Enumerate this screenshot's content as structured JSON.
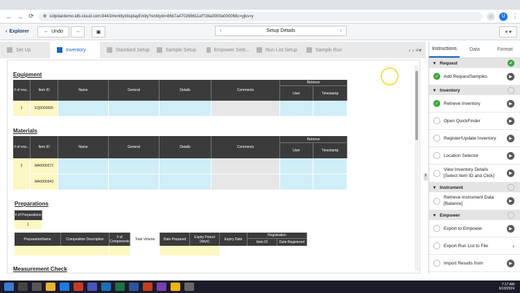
{
  "browser": {
    "url": "solpdardemo.idb-cloud.com:8443/#entity/displayEntity?entityId=86b7a470268611ef?28a0000a000068c=yjks=y"
  },
  "toolbar": {
    "explorer": "Explorer",
    "undo": "Undo",
    "title": "Setup Details"
  },
  "tabs": [
    "Set Up",
    "Inventory",
    "Standard Setup",
    "Sample Setup",
    "Empower Setti...",
    "Run List Setup",
    "Sample Run"
  ],
  "sections": {
    "equipment": "Equipment",
    "materials": "Materials",
    "preparations": "Preparations",
    "measurement": "Measurement Check"
  },
  "equip_headers": [
    "# of row...",
    "Item ID",
    "Name",
    "General",
    "Details",
    "Comments",
    "Retrieve",
    "User",
    "Timestamp"
  ],
  "equip_row": {
    "n": "1",
    "id": "EQ0000005"
  },
  "mat_headers": [
    "# of row...",
    "Item ID",
    "Name",
    "General",
    "Details",
    "Comments",
    "Retrieve",
    "User",
    "Timestamp"
  ],
  "mat_rows": {
    "n": "2",
    "id1": "MA0000272",
    "id2": "MA0000343"
  },
  "prep_count_header": "# of Preparations",
  "prep_count": "1",
  "prep_headers": [
    "PreparationName",
    "Composition Description",
    "# of Components",
    "Total Volume",
    "Date Prepared",
    "Expiry Period (days)",
    "Expiry Date",
    "Registration",
    "Item ID",
    "Date Registered"
  ],
  "right_tabs": [
    "Instructions",
    "Data",
    "Format"
  ],
  "right": {
    "request": "Request",
    "add_samples": "Add RequestSamples",
    "inventory": "Inventory",
    "retrieve_inventory": "Retrieve Inventory",
    "open_quickfinder": "Open QuickFinder",
    "register_update": "Register/Update Inventory",
    "location_selector": "Location Selector",
    "view_inventory": "View Inventory Details",
    "view_inventory_sub": "[Select Item ID and Click]",
    "instrument": "Instrument",
    "retrieve_instr": "Retrieve Instrument Data",
    "retrieve_instr_sub": "[Balance]",
    "empower": "Empower",
    "export_empower": "Export to Empower",
    "export_runlist": "Export Run List to File",
    "import_results": "Import Results from"
  },
  "taskbar": {
    "time": "7:17 AM",
    "date": "6/19/2024"
  }
}
